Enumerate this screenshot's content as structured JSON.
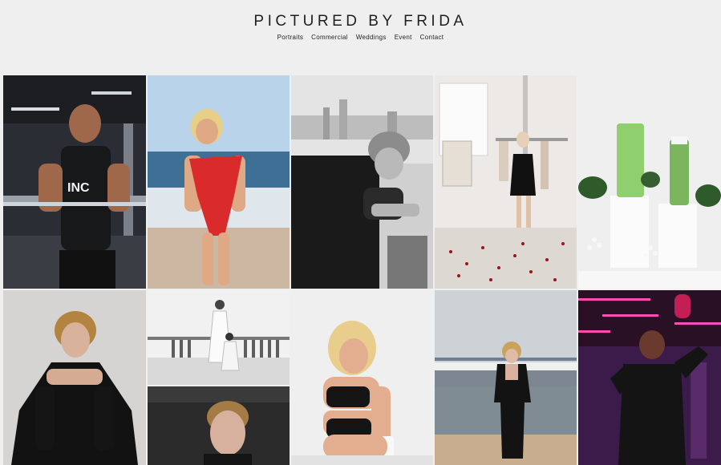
{
  "site": {
    "title": "PICTURED BY FRIDA"
  },
  "nav": {
    "items": [
      "Portraits",
      "Commercial",
      "Weddings",
      "Event",
      "Contact"
    ]
  },
  "gallery": {
    "photos": [
      {
        "name": "photo-gym-athlete",
        "shirt_text": "INC"
      },
      {
        "name": "photo-beach-red-swimsuit"
      },
      {
        "name": "photo-bw-city-portrait"
      },
      {
        "name": "photo-studio-roses-black-dress"
      },
      {
        "name": "photo-product-green-tubes"
      },
      {
        "name": "photo-black-suit-seated"
      },
      {
        "name": "photo-bw-wedding-child"
      },
      {
        "name": "photo-blonde-sportswear"
      },
      {
        "name": "photo-beach-black-suit"
      },
      {
        "name": "photo-neon-gym-portrait"
      },
      {
        "name": "photo-moody-close-portrait"
      }
    ]
  },
  "colors": {
    "background": "#efefef",
    "text": "#222222"
  }
}
